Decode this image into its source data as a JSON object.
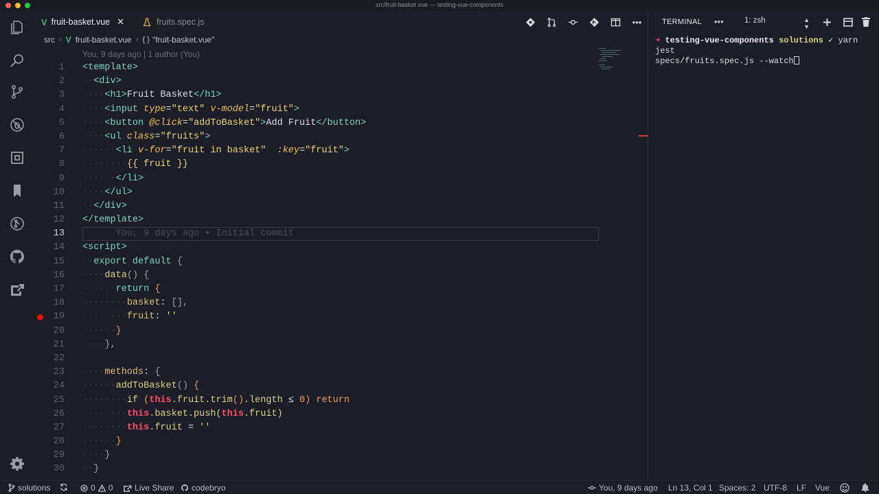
{
  "window": {
    "title": "src/fruit-basket.vue — testing-vue-components"
  },
  "tabs": [
    {
      "label": "fruit-basket.vue",
      "icon": "vue-icon",
      "active": true
    },
    {
      "label": "fruits.spec.js",
      "icon": "flask-icon",
      "active": false
    }
  ],
  "tab_close_glyph": "✕",
  "editor_actions": [
    "git-compare-icon",
    "pull-request-icon",
    "timeline-icon",
    "git-commit-icon",
    "split-editor-icon",
    "more-icon"
  ],
  "editor_actions_more": "•••",
  "breadcrumb": {
    "folder": "src",
    "file": "fruit-basket.vue",
    "symbol_prefix": "{ }",
    "symbol": "\"fruit-basket.vue\""
  },
  "codelens": "You, 9 days ago | 1 author (You)",
  "code_lines": [
    {
      "n": "1"
    },
    {
      "n": "2"
    },
    {
      "n": "3"
    },
    {
      "n": "4"
    },
    {
      "n": "5"
    },
    {
      "n": "6"
    },
    {
      "n": "7"
    },
    {
      "n": "8"
    },
    {
      "n": "9"
    },
    {
      "n": "10"
    },
    {
      "n": "11"
    },
    {
      "n": "12"
    },
    {
      "n": "13"
    },
    {
      "n": "14"
    },
    {
      "n": "15"
    },
    {
      "n": "16"
    },
    {
      "n": "17"
    },
    {
      "n": "18"
    },
    {
      "n": "19"
    },
    {
      "n": "20"
    },
    {
      "n": "21"
    },
    {
      "n": "22"
    },
    {
      "n": "23"
    },
    {
      "n": "24"
    },
    {
      "n": "25"
    },
    {
      "n": "26"
    },
    {
      "n": "27"
    },
    {
      "n": "28"
    },
    {
      "n": "29"
    },
    {
      "n": "30"
    }
  ],
  "code": {
    "l1_tag": "<template>",
    "l2_tag": "<div>",
    "l3_open": "<h1>",
    "l3_text": "Fruit Basket",
    "l3_close": "</h1>",
    "l4_open": "<input",
    "l4_attr1": "type",
    "l4_eq1": "=",
    "l4_val1": "\"text\"",
    "l4_attr2": "v-model",
    "l4_eq2": "=",
    "l4_val2": "\"fruit\"",
    "l4_close": ">",
    "l5_open": "<button",
    "l5_attr": "@click",
    "l5_eq": "=",
    "l5_val": "\"addToBasket\"",
    "l5_gt": ">",
    "l5_text": "Add Fruit",
    "l5_close": "</button>",
    "l6_open": "<ul",
    "l6_attr": "class",
    "l6_eq": "=",
    "l6_val": "\"fruits\"",
    "l6_close": ">",
    "l7_open": "<li",
    "l7_attr1": "v-for",
    "l7_eq1": "=",
    "l7_val1": "\"fruit in basket\"",
    "l7_attr2": ":key",
    "l7_eq2": "=",
    "l7_val2": "\"fruit\"",
    "l7_close": ">",
    "l8_text": "{{ fruit }}",
    "l9_tag": "</li>",
    "l10_tag": "</ul>",
    "l11_tag": "</div>",
    "l12_tag": "</template>",
    "l13_blame": "You, 9 days ago • Initial commit",
    "l14_tag": "<script>",
    "l15_kw": "export default",
    "l15_br": "{",
    "l16_fn": "data",
    "l16_par": "()",
    "l16_br": "{",
    "l17_kw": "return",
    "l17_br": "{",
    "l18_prop": "basket",
    "l18_colon": ":",
    "l18_val": "[],",
    "l19_prop": "fruit",
    "l19_colon": ":",
    "l19_val": "''",
    "l20_br": "}",
    "l21_br": "},",
    "l23_prop": "methods",
    "l23_colon": ":",
    "l23_br": "{",
    "l24_fn": "addToBasket",
    "l24_par": "()",
    "l24_br": "{",
    "l25_kw": "if",
    "l25_p1": "(",
    "l25_this": "this",
    "l25_chain": ".fruit.trim",
    "l25_p2": "()",
    "l25_len": ".length",
    "l25_op": "≤",
    "l25_num": "0",
    "l25_p3": ")",
    "l25_ret": "return",
    "l26_this1": "this",
    "l26_chain": ".basket.push(",
    "l26_this2": "this",
    "l26_end": ".fruit)",
    "l27_this": "this",
    "l27_chain": ".fruit",
    "l27_eq": "=",
    "l27_val": "''",
    "l28_br": "}",
    "l29_br": "}",
    "l30_br": "}"
  },
  "breakpoint_line": "19",
  "terminal": {
    "title": "TERMINAL",
    "more": "•••",
    "shell": "1: zsh",
    "prompt_arrow": "➜",
    "prompt_dir": "testing-vue-components",
    "prompt_branch": "solutions",
    "prompt_check": "✓",
    "command_part1": "yarn jest",
    "command_part2": "specs/fruits.spec.js --watch"
  },
  "statusbar": {
    "branch": "solutions",
    "errors": "0",
    "warnings": "0",
    "live_share": "Live Share",
    "user": "codebryo",
    "blame": "You, 9 days ago",
    "position": "Ln 13, Col 1",
    "spaces": "Spaces: 2",
    "encoding": "UTF-8",
    "eol": "LF",
    "language": "Vue"
  },
  "colors": {
    "background": "#1c1d26",
    "tag": "#7ed3c5",
    "attribute": "#e7c15a",
    "this_keyword": "#ff4d6d",
    "breakpoint": "#e51400",
    "vue_green": "#41b883"
  }
}
